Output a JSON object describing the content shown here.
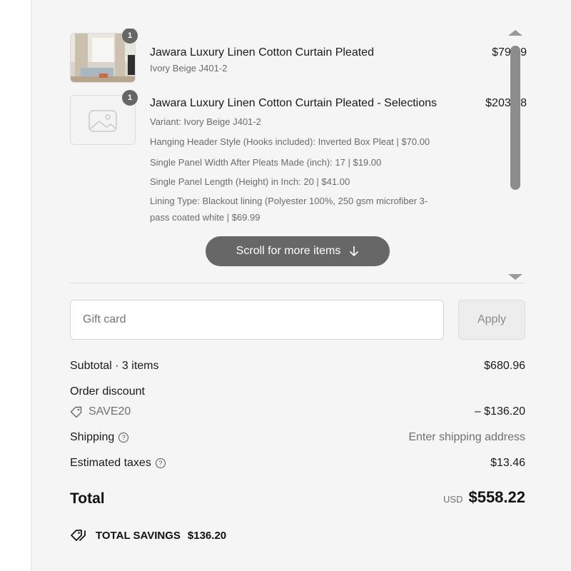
{
  "colors": {
    "panel_bg": "#f5f5f5",
    "badge_bg": "#666666",
    "pill_bg": "#5a5a5a"
  },
  "items": [
    {
      "quantity": "1",
      "title": "Jawara Luxury Linen Cotton Curtain Pleated",
      "subtitle": "Ivory Beige J401-2",
      "price": "$79.99",
      "thumbnail": "curtain-photo"
    },
    {
      "quantity": "1",
      "title": "Jawara Luxury Linen Cotton Curtain Pleated - Selections",
      "variant": "Variant: Ivory Beige J401-2",
      "props": [
        "Hanging Header Style (Hooks included): Inverted Box Pleat | $70.00",
        "Single Panel Width After Pleats Made (inch): 17 | $19.00",
        "Single Panel Length (Height) in Inch: 20 | $41.00",
        "Lining Type: Blackout lining (Polyester 100%, 250 gsm microfiber 3-pass coated white | $69.99"
      ],
      "price": "$203.98",
      "thumbnail": "image-placeholder-icon"
    }
  ],
  "scroll_hint": {
    "label": "Scroll for more items",
    "icon": "arrow-down-icon"
  },
  "gift_card": {
    "placeholder": "Gift card",
    "apply_label": "Apply"
  },
  "summary": {
    "subtotal_label": "Subtotal · 3 items",
    "subtotal_value": "$680.96",
    "order_discount_label": "Order discount",
    "discount_code": "SAVE20",
    "discount_value": "– $136.20",
    "shipping_label": "Shipping",
    "shipping_value": "Enter shipping address",
    "taxes_label": "Estimated taxes",
    "taxes_value": "$13.46"
  },
  "total": {
    "label": "Total",
    "currency": "USD",
    "amount": "$558.22"
  },
  "savings": {
    "label": "TOTAL SAVINGS",
    "amount": "$136.20"
  }
}
